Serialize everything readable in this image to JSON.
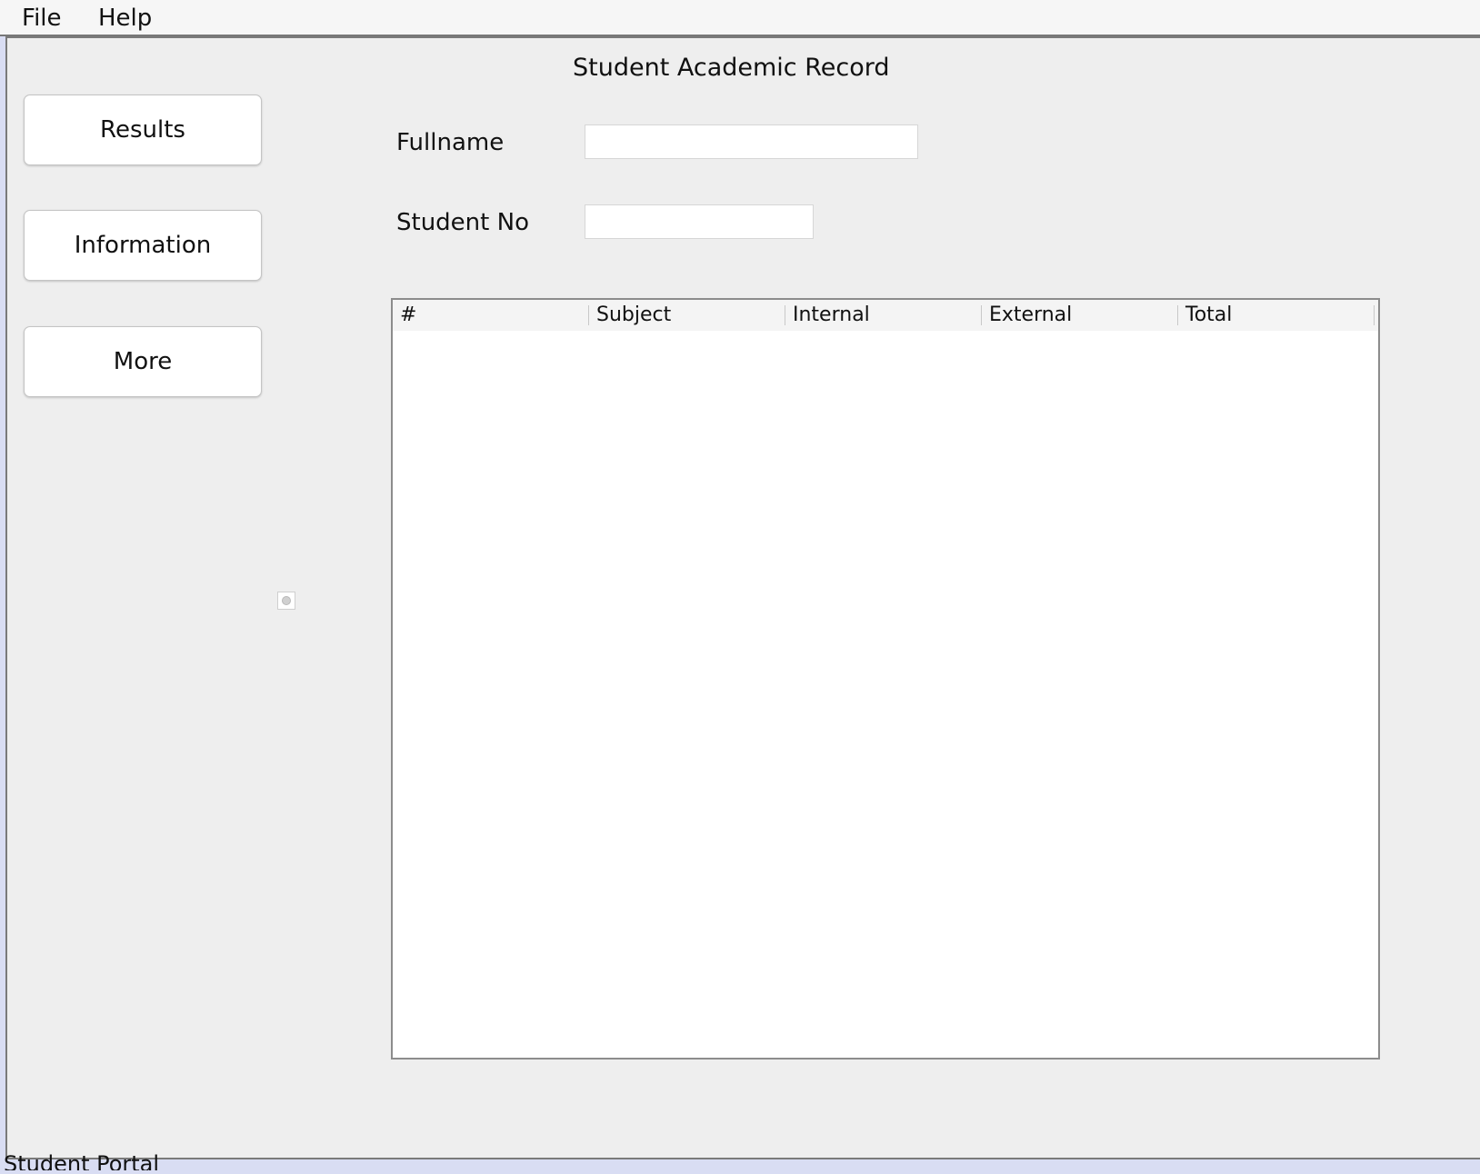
{
  "menu": {
    "file": "File",
    "help": "Help"
  },
  "title": "Student Academic Record",
  "sidebar": {
    "results": "Results",
    "information": "Information",
    "more": "More"
  },
  "form": {
    "fullname_label": "Fullname",
    "fullname_value": "",
    "student_no_label": "Student No",
    "student_no_value": ""
  },
  "table": {
    "columns": [
      "#",
      "Subject",
      "Internal",
      "External",
      "Total"
    ],
    "rows": []
  },
  "status": "Student Portal"
}
